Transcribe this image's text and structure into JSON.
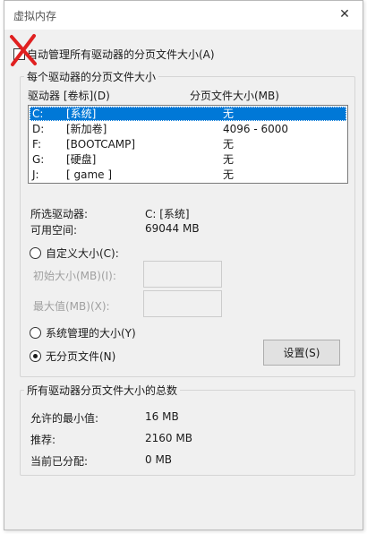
{
  "window": {
    "title": "虚拟内存",
    "close_glyph": "✕"
  },
  "auto_manage": {
    "label": "自动管理所有驱动器的分页文件大小(A)",
    "label_visible": "自动管理所有驱动器的分页文件大小(A)",
    "checked": false
  },
  "drives_group": {
    "label": "每个驱动器的分页文件大小",
    "col_drive": "驱动器 [卷标](D)",
    "col_size": "分页文件大小(MB)",
    "rows": [
      {
        "letter": "C:",
        "label": "[系统]",
        "size": "无",
        "selected": true
      },
      {
        "letter": "D:",
        "label": "[新加卷]",
        "size": "4096 - 6000",
        "selected": false
      },
      {
        "letter": "F:",
        "label": "[BOOTCAMP]",
        "size": "无",
        "selected": false
      },
      {
        "letter": "G:",
        "label": "[硬盘]",
        "size": "无",
        "selected": false
      },
      {
        "letter": "J:",
        "label": "[ game ]",
        "size": "无",
        "selected": false
      }
    ],
    "selected_drive_label": "所选驱动器:",
    "selected_drive_value": "C:  [系统]",
    "free_space_label": "可用空间:",
    "free_space_value": "69044 MB",
    "custom_size_label": "自定义大小(C):",
    "initial_size_label": "初始大小(MB)(I):",
    "max_size_label": "最大值(MB)(X):",
    "initial_size_value": "",
    "max_size_value": "",
    "system_managed_label": "系统管理的大小(Y)",
    "no_paging_label": "无分页文件(N)",
    "selected_option": "no_paging",
    "set_button": "设置(S)"
  },
  "totals_group": {
    "label": "所有驱动器分页文件大小的总数",
    "min_allowed_label": "允许的最小值:",
    "min_allowed_value": "16 MB",
    "recommended_label": "推荐:",
    "recommended_value": "2160 MB",
    "current_label": "当前已分配:",
    "current_value": "0 MB"
  },
  "colors": {
    "selection": "#0078d7",
    "annotation_x": "#e02020",
    "dialog_bg": "#f0f0f0"
  }
}
